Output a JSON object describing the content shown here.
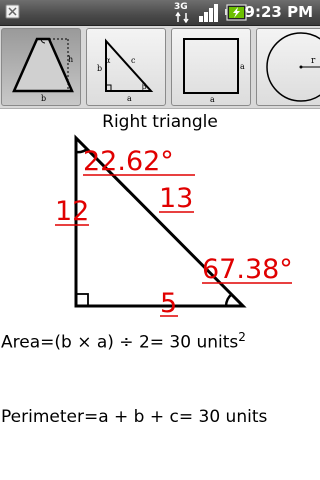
{
  "status_bar": {
    "network_label": "3G",
    "time": "9:23 PM",
    "icons": [
      "notification-icon",
      "3g-data-icon",
      "signal-icon",
      "battery-icon"
    ]
  },
  "shape_tabs": [
    {
      "name": "trapezoid",
      "selected": true,
      "labels": {
        "h": "h",
        "b": "b"
      }
    },
    {
      "name": "right-triangle",
      "selected": false,
      "labels": {
        "alpha": "α",
        "b": "b",
        "c": "c",
        "a": "a",
        "beta": "β"
      }
    },
    {
      "name": "square",
      "selected": false,
      "labels": {
        "right": "a",
        "bottom": "a"
      }
    },
    {
      "name": "circle",
      "selected": false,
      "labels": {
        "r": "r"
      }
    }
  ],
  "title": "Right triangle",
  "triangle": {
    "angle_top": "22.62°",
    "angle_bottom_right": "67.38°",
    "side_left": "12",
    "side_hypotenuse": "13",
    "side_bottom": "5"
  },
  "area": {
    "prefix": "Area=",
    "formula": "(b × a) ÷ 2",
    "equals": "= 30 units",
    "exponent": "2"
  },
  "perimeter": {
    "prefix": "Perimeter=",
    "formula": "a + b + c",
    "equals": "= 30 units"
  },
  "colors": {
    "label_red": "#e00000",
    "status_bar": "#4a4a4a",
    "battery_green": "#6cc000"
  }
}
